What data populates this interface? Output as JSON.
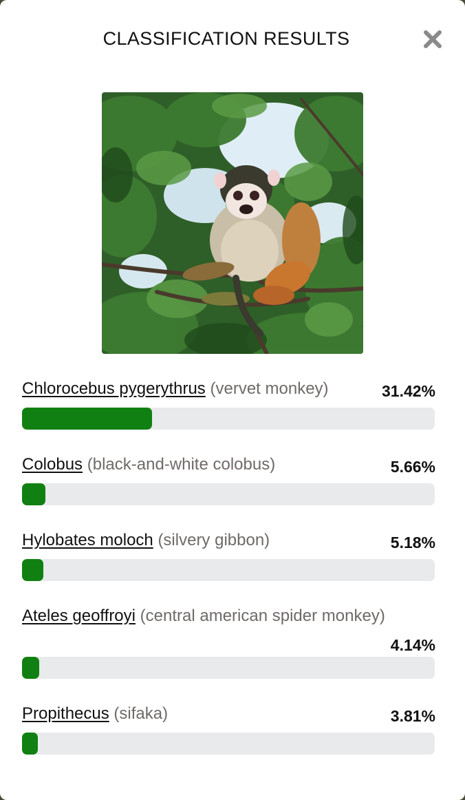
{
  "modal": {
    "title": "CLASSIFICATION RESULTS",
    "close_icon": "close-x-icon",
    "image": {
      "subject": "squirrel monkey perched in a leafy tree",
      "colors": {
        "foliage": "#2f6b2a",
        "sky": "#dfeef6",
        "fur": "#c9bfa8",
        "limbs": "#c9762e"
      }
    }
  },
  "colors": {
    "bar_fill": "#118012",
    "bar_track": "#e8eaec",
    "common_name": "#6f6a67"
  },
  "results": [
    {
      "scientific": "Chlorocebus pygerythrus",
      "common": "(vervet monkey)",
      "percent_label": "31.42%",
      "percent": 31.42
    },
    {
      "scientific": "Colobus",
      "common": "(black-and-white colobus)",
      "percent_label": "5.66%",
      "percent": 5.66
    },
    {
      "scientific": "Hylobates moloch",
      "common": "(silvery gibbon)",
      "percent_label": "5.18%",
      "percent": 5.18
    },
    {
      "scientific": "Ateles geoffroyi",
      "common": "(central american spider monkey)",
      "percent_label": "4.14%",
      "percent": 4.14
    },
    {
      "scientific": "Propithecus",
      "common": "(sifaka)",
      "percent_label": "3.81%",
      "percent": 3.81
    }
  ]
}
